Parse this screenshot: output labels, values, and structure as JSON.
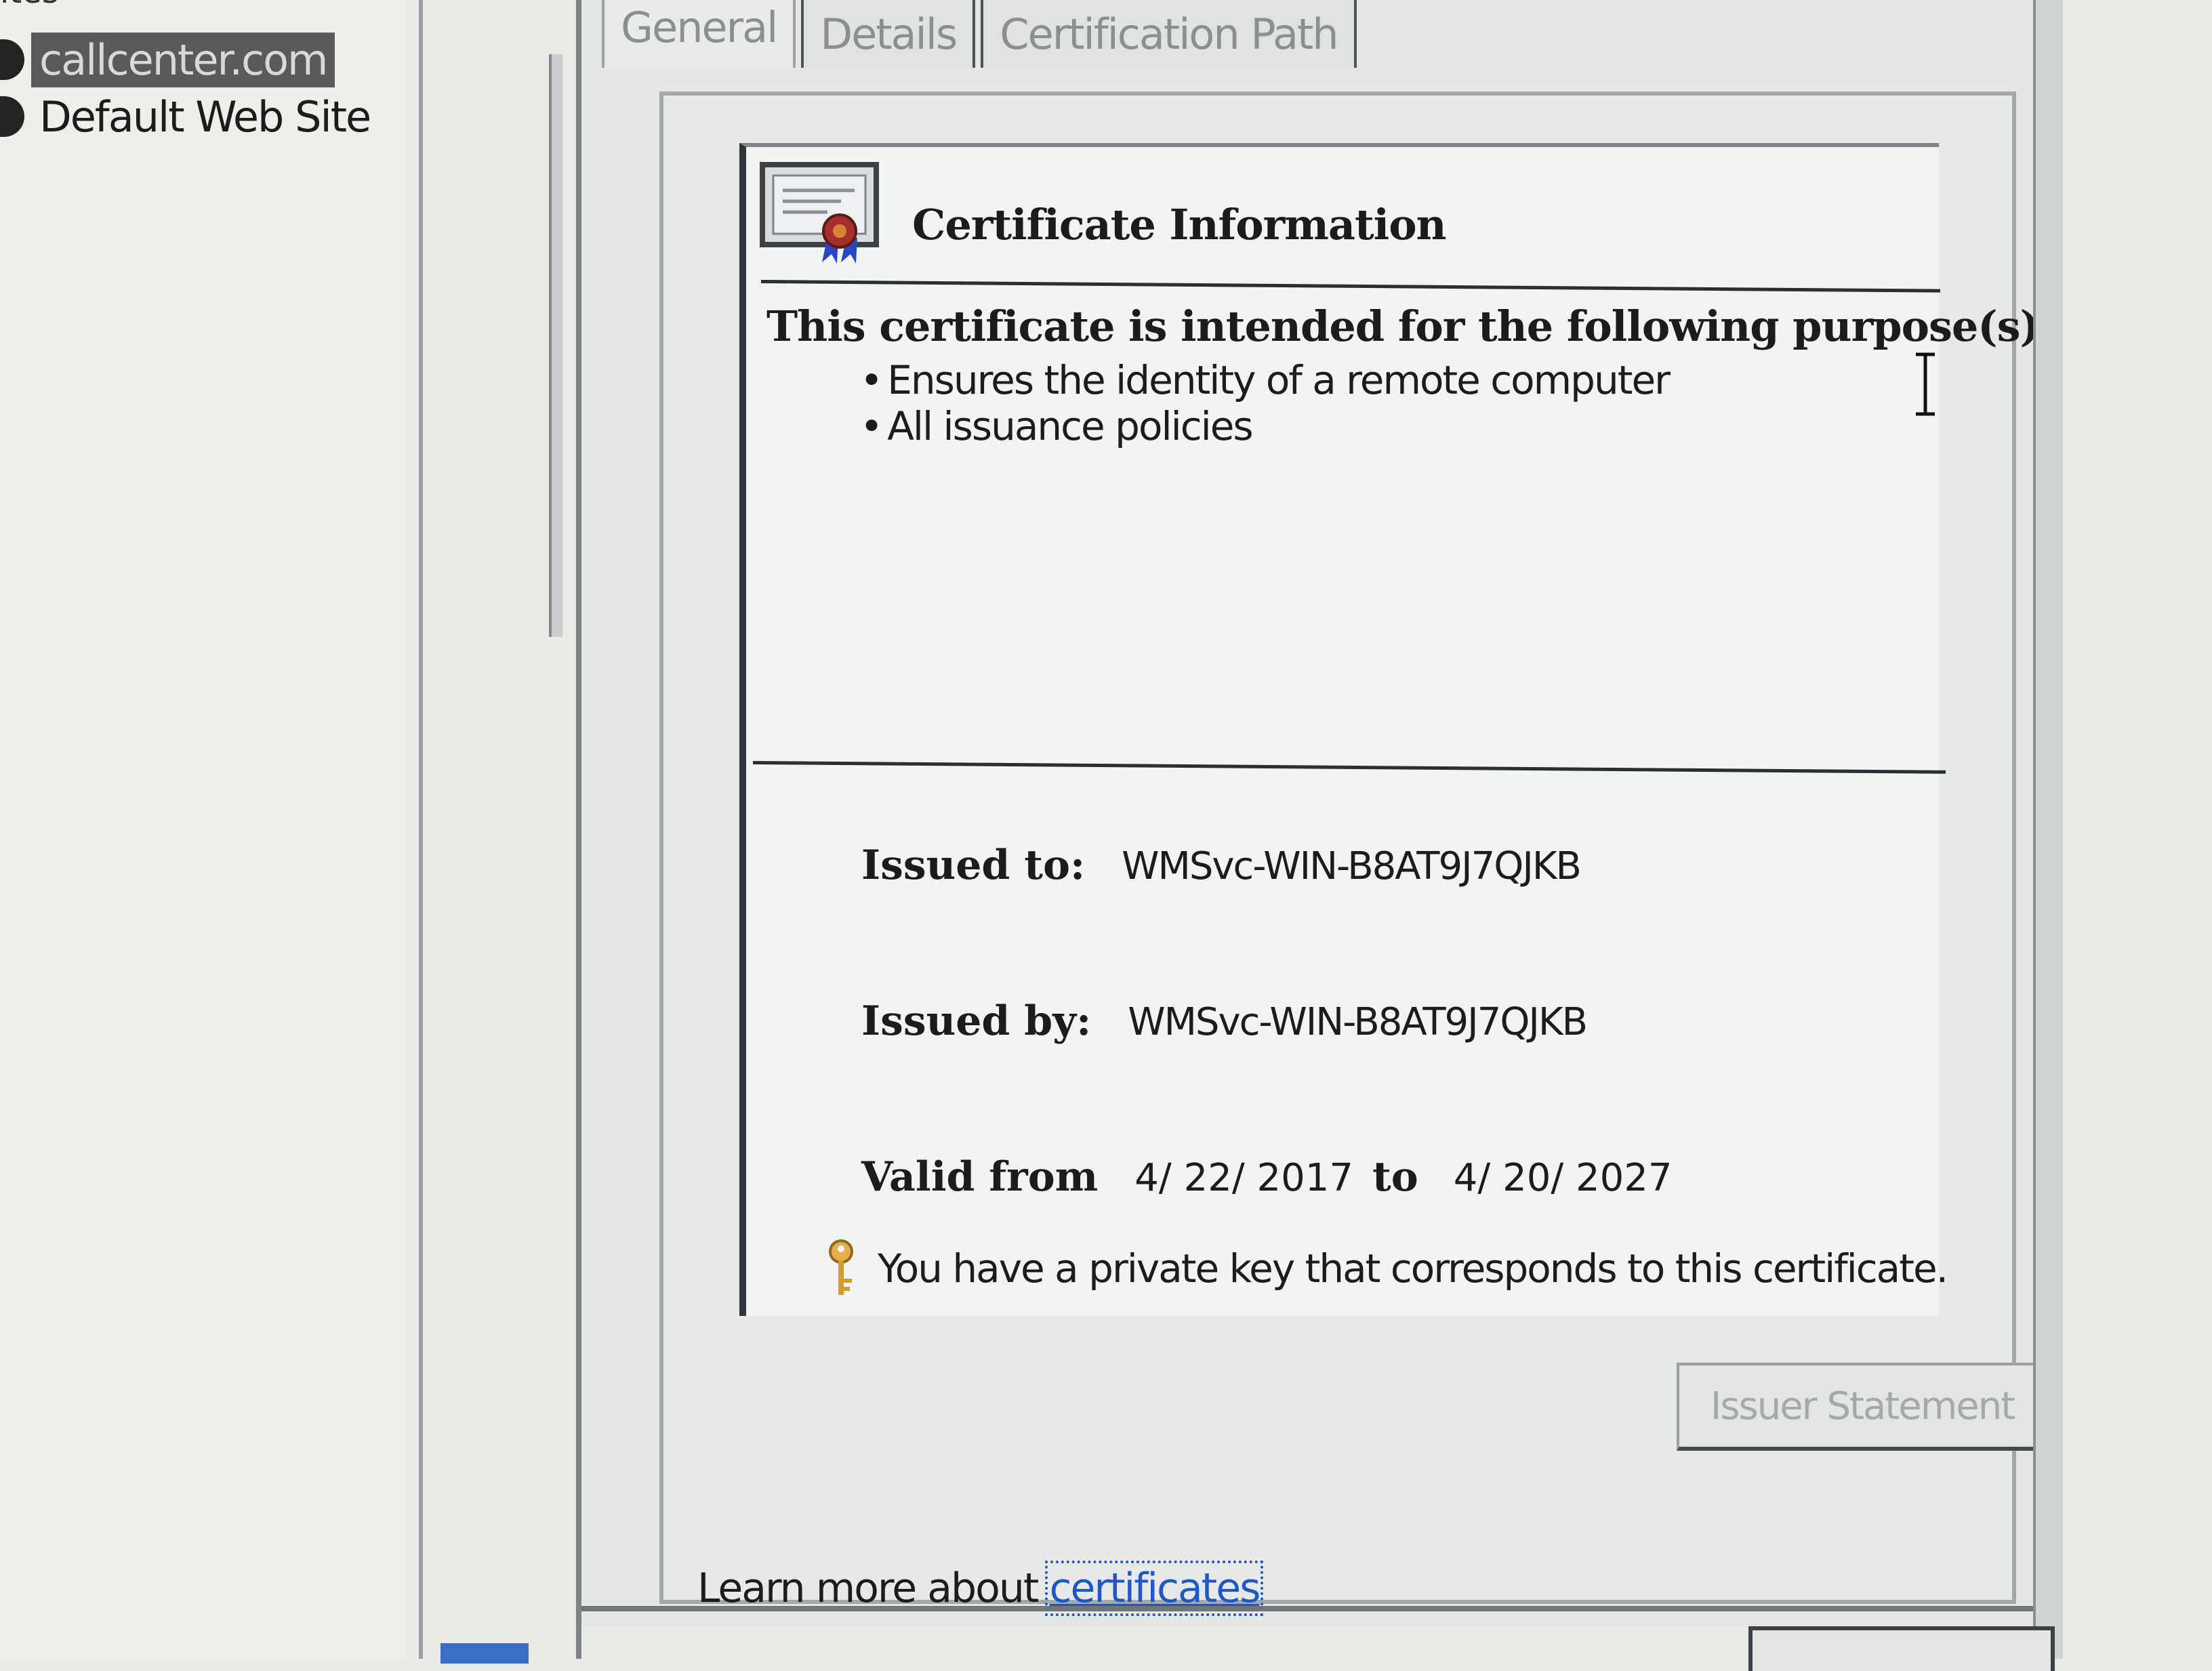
{
  "tree": {
    "cut_label": "ites",
    "nodes": [
      {
        "label": "callcenter.com",
        "selected": true
      },
      {
        "label": "Default Web Site",
        "selected": false
      }
    ]
  },
  "dialog": {
    "tabs": [
      {
        "label": "General",
        "active": true
      },
      {
        "label": "Details",
        "active": false
      },
      {
        "label": "Certification Path",
        "active": false
      }
    ],
    "certificate_information_title": "Certificate Information",
    "purpose_heading": "This certificate is intended for the following purpose(s):",
    "purposes": [
      "Ensures the identity of a remote computer",
      "All issuance policies"
    ],
    "issued_to_label": "Issued to:",
    "issued_to_value": "WMSvc-WIN-B8AT9J7QJKB",
    "issued_by_label": "Issued by:",
    "issued_by_value": "WMSvc-WIN-B8AT9J7QJKB",
    "valid_from_label": "Valid from",
    "valid_from_date": "4/ 22/ 2017",
    "valid_to_word": "to",
    "valid_to_date": "4/ 20/ 2027",
    "private_key_text": "You have a private key that corresponds to this certificate.",
    "issuer_statement_button": "Issuer Statement",
    "learn_more_text": "Learn more about ",
    "learn_more_link": "certificates"
  },
  "icons": {
    "certificate": "certificate-icon",
    "key": "key-icon",
    "cursor": "text-cursor-icon"
  },
  "colors": {
    "link": "#1f56c9",
    "selected_tree_bg": "#5a5a5a",
    "disabled_text": "#a4a9ab"
  }
}
